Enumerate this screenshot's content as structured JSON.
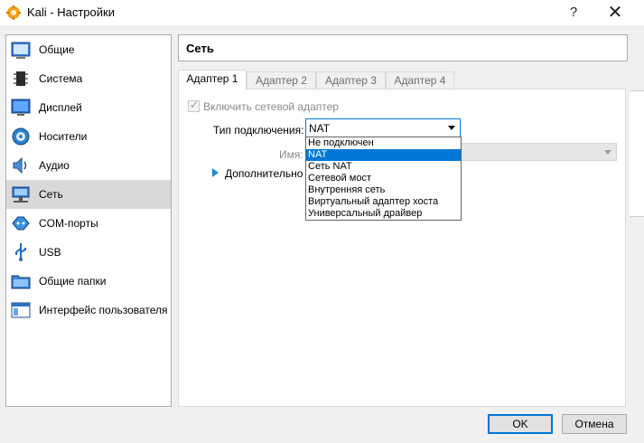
{
  "window": {
    "title": "Kali - Настройки",
    "help_glyph": "?",
    "close_glyph": "✕"
  },
  "sidebar": {
    "items": [
      {
        "label": "Общие",
        "icon": "general-icon"
      },
      {
        "label": "Система",
        "icon": "system-chip-icon"
      },
      {
        "label": "Дисплей",
        "icon": "display-monitor-icon"
      },
      {
        "label": "Носители",
        "icon": "storage-disc-icon"
      },
      {
        "label": "Аудио",
        "icon": "speaker-icon"
      },
      {
        "label": "Сеть",
        "icon": "network-icon",
        "selected": true
      },
      {
        "label": "COM-порты",
        "icon": "com-port-icon"
      },
      {
        "label": "USB",
        "icon": "usb-icon"
      },
      {
        "label": "Общие папки",
        "icon": "shared-folder-icon"
      },
      {
        "label": "Интерфейс пользователя",
        "icon": "user-interface-icon"
      }
    ]
  },
  "header": {
    "title": "Сеть"
  },
  "tabs": [
    {
      "label": "Адаптер 1",
      "active": true
    },
    {
      "label": "Адаптер 2"
    },
    {
      "label": "Адаптер 3"
    },
    {
      "label": "Адаптер 4"
    }
  ],
  "adapter": {
    "enable_label": "Включить сетевой адаптер",
    "enabled": true,
    "connection_type_label": "Тип подключения:",
    "connection_type_value": "NAT",
    "name_label": "Имя:",
    "name_value": "",
    "advanced_label": "Дополнительно"
  },
  "dropdown": {
    "options": [
      "Не подключен",
      "NAT",
      "Сеть NAT",
      "Сетевой мост",
      "Внутренняя сеть",
      "Виртуальный адаптер хоста",
      "Универсальный драйвер"
    ],
    "selected": "NAT"
  },
  "buttons": {
    "ok": "OK",
    "cancel": "Отмена"
  },
  "colors": {
    "accent": "#0078d7",
    "selected_sidebar": "#d9d9d9"
  }
}
